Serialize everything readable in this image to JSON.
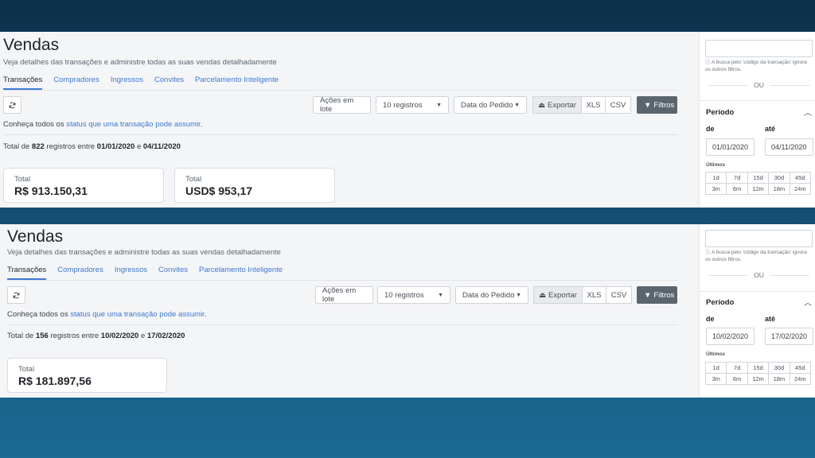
{
  "screens": [
    {
      "title": "Vendas",
      "subtitle": "Veja detalhes das transações e administre todas as suas vendas detalhadamente",
      "tabs": [
        "Transações",
        "Compradores",
        "Ingressos",
        "Convites",
        "Parcelamento Inteligente"
      ],
      "actions_label": "Ações em lote",
      "registros_label": "10 registros",
      "order_label": "Data do Pedido",
      "export_label": "Exportar",
      "xls_label": "XLS",
      "csv_label": "CSV",
      "filtros_label": "Filtros",
      "info_prefix": "Conheça todos os ",
      "info_link": "status que uma transação pode assumir",
      "info_suffix": ".",
      "total_prefix": "Total de ",
      "total_count": "822",
      "total_mid": " registros entre ",
      "total_start": "01/01/2020",
      "total_and": " e ",
      "total_end": "04/11/2020",
      "cards": [
        {
          "label": "Total",
          "value": "R$ 913.150,31"
        },
        {
          "label": "Total",
          "value": "USD$ 953,17"
        }
      ],
      "side": {
        "hint": "ⓘ A busca pelo 'código da transação' ignora os outros filtros.",
        "ou": "OU",
        "periodo": "Período",
        "de_label": "de",
        "ate_label": "até",
        "de_value": "01/01/2020",
        "ate_value": "04/11/2020",
        "ultimos": "Últimos",
        "ranges": [
          "1d",
          "7d",
          "15d",
          "30d",
          "45d",
          "3m",
          "6m",
          "12m",
          "18m",
          "24m"
        ]
      }
    },
    {
      "title": "Vendas",
      "subtitle": "Veja detalhes das transações e administre todas as suas vendas detalhadamente",
      "tabs": [
        "Transações",
        "Compradores",
        "Ingressos",
        "Convites",
        "Parcelamento Inteligente"
      ],
      "actions_label": "Ações em lote",
      "registros_label": "10 registros",
      "order_label": "Data do Pedido",
      "export_label": "Exportar",
      "xls_label": "XLS",
      "csv_label": "CSV",
      "filtros_label": "Filtros",
      "info_prefix": "Conheça todos os ",
      "info_link": "status que uma transação pode assumir",
      "info_suffix": ".",
      "total_prefix": "Total de ",
      "total_count": "156",
      "total_mid": " registros entre ",
      "total_start": "10/02/2020",
      "total_and": " e ",
      "total_end": "17/02/2020",
      "cards": [
        {
          "label": "Total",
          "value": "R$ 181.897,56"
        }
      ],
      "side": {
        "hint": "ⓘ A busca pelo 'código da transação' ignora os outros filtros.",
        "ou": "OU",
        "periodo": "Período",
        "de_label": "de",
        "ate_label": "até",
        "de_value": "10/02/2020",
        "ate_value": "17/02/2020",
        "ultimos": "Últimos",
        "ranges": [
          "1d",
          "7d",
          "15d",
          "30d",
          "45d",
          "3m",
          "6m",
          "12m",
          "18m",
          "24m"
        ]
      }
    }
  ]
}
